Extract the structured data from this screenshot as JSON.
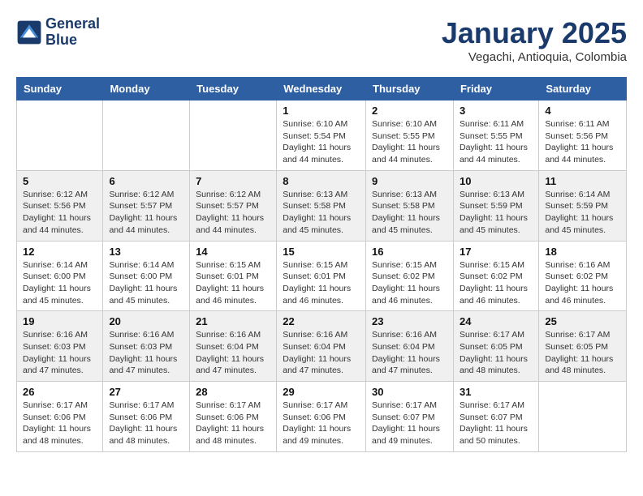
{
  "header": {
    "logo_line1": "General",
    "logo_line2": "Blue",
    "month_title": "January 2025",
    "location": "Vegachi, Antioquia, Colombia"
  },
  "weekdays": [
    "Sunday",
    "Monday",
    "Tuesday",
    "Wednesday",
    "Thursday",
    "Friday",
    "Saturday"
  ],
  "weeks": [
    [
      {
        "day": "",
        "sunrise": "",
        "sunset": "",
        "daylight": ""
      },
      {
        "day": "",
        "sunrise": "",
        "sunset": "",
        "daylight": ""
      },
      {
        "day": "",
        "sunrise": "",
        "sunset": "",
        "daylight": ""
      },
      {
        "day": "1",
        "sunrise": "Sunrise: 6:10 AM",
        "sunset": "Sunset: 5:54 PM",
        "daylight": "Daylight: 11 hours and 44 minutes."
      },
      {
        "day": "2",
        "sunrise": "Sunrise: 6:10 AM",
        "sunset": "Sunset: 5:55 PM",
        "daylight": "Daylight: 11 hours and 44 minutes."
      },
      {
        "day": "3",
        "sunrise": "Sunrise: 6:11 AM",
        "sunset": "Sunset: 5:55 PM",
        "daylight": "Daylight: 11 hours and 44 minutes."
      },
      {
        "day": "4",
        "sunrise": "Sunrise: 6:11 AM",
        "sunset": "Sunset: 5:56 PM",
        "daylight": "Daylight: 11 hours and 44 minutes."
      }
    ],
    [
      {
        "day": "5",
        "sunrise": "Sunrise: 6:12 AM",
        "sunset": "Sunset: 5:56 PM",
        "daylight": "Daylight: 11 hours and 44 minutes."
      },
      {
        "day": "6",
        "sunrise": "Sunrise: 6:12 AM",
        "sunset": "Sunset: 5:57 PM",
        "daylight": "Daylight: 11 hours and 44 minutes."
      },
      {
        "day": "7",
        "sunrise": "Sunrise: 6:12 AM",
        "sunset": "Sunset: 5:57 PM",
        "daylight": "Daylight: 11 hours and 44 minutes."
      },
      {
        "day": "8",
        "sunrise": "Sunrise: 6:13 AM",
        "sunset": "Sunset: 5:58 PM",
        "daylight": "Daylight: 11 hours and 45 minutes."
      },
      {
        "day": "9",
        "sunrise": "Sunrise: 6:13 AM",
        "sunset": "Sunset: 5:58 PM",
        "daylight": "Daylight: 11 hours and 45 minutes."
      },
      {
        "day": "10",
        "sunrise": "Sunrise: 6:13 AM",
        "sunset": "Sunset: 5:59 PM",
        "daylight": "Daylight: 11 hours and 45 minutes."
      },
      {
        "day": "11",
        "sunrise": "Sunrise: 6:14 AM",
        "sunset": "Sunset: 5:59 PM",
        "daylight": "Daylight: 11 hours and 45 minutes."
      }
    ],
    [
      {
        "day": "12",
        "sunrise": "Sunrise: 6:14 AM",
        "sunset": "Sunset: 6:00 PM",
        "daylight": "Daylight: 11 hours and 45 minutes."
      },
      {
        "day": "13",
        "sunrise": "Sunrise: 6:14 AM",
        "sunset": "Sunset: 6:00 PM",
        "daylight": "Daylight: 11 hours and 45 minutes."
      },
      {
        "day": "14",
        "sunrise": "Sunrise: 6:15 AM",
        "sunset": "Sunset: 6:01 PM",
        "daylight": "Daylight: 11 hours and 46 minutes."
      },
      {
        "day": "15",
        "sunrise": "Sunrise: 6:15 AM",
        "sunset": "Sunset: 6:01 PM",
        "daylight": "Daylight: 11 hours and 46 minutes."
      },
      {
        "day": "16",
        "sunrise": "Sunrise: 6:15 AM",
        "sunset": "Sunset: 6:02 PM",
        "daylight": "Daylight: 11 hours and 46 minutes."
      },
      {
        "day": "17",
        "sunrise": "Sunrise: 6:15 AM",
        "sunset": "Sunset: 6:02 PM",
        "daylight": "Daylight: 11 hours and 46 minutes."
      },
      {
        "day": "18",
        "sunrise": "Sunrise: 6:16 AM",
        "sunset": "Sunset: 6:02 PM",
        "daylight": "Daylight: 11 hours and 46 minutes."
      }
    ],
    [
      {
        "day": "19",
        "sunrise": "Sunrise: 6:16 AM",
        "sunset": "Sunset: 6:03 PM",
        "daylight": "Daylight: 11 hours and 47 minutes."
      },
      {
        "day": "20",
        "sunrise": "Sunrise: 6:16 AM",
        "sunset": "Sunset: 6:03 PM",
        "daylight": "Daylight: 11 hours and 47 minutes."
      },
      {
        "day": "21",
        "sunrise": "Sunrise: 6:16 AM",
        "sunset": "Sunset: 6:04 PM",
        "daylight": "Daylight: 11 hours and 47 minutes."
      },
      {
        "day": "22",
        "sunrise": "Sunrise: 6:16 AM",
        "sunset": "Sunset: 6:04 PM",
        "daylight": "Daylight: 11 hours and 47 minutes."
      },
      {
        "day": "23",
        "sunrise": "Sunrise: 6:16 AM",
        "sunset": "Sunset: 6:04 PM",
        "daylight": "Daylight: 11 hours and 47 minutes."
      },
      {
        "day": "24",
        "sunrise": "Sunrise: 6:17 AM",
        "sunset": "Sunset: 6:05 PM",
        "daylight": "Daylight: 11 hours and 48 minutes."
      },
      {
        "day": "25",
        "sunrise": "Sunrise: 6:17 AM",
        "sunset": "Sunset: 6:05 PM",
        "daylight": "Daylight: 11 hours and 48 minutes."
      }
    ],
    [
      {
        "day": "26",
        "sunrise": "Sunrise: 6:17 AM",
        "sunset": "Sunset: 6:06 PM",
        "daylight": "Daylight: 11 hours and 48 minutes."
      },
      {
        "day": "27",
        "sunrise": "Sunrise: 6:17 AM",
        "sunset": "Sunset: 6:06 PM",
        "daylight": "Daylight: 11 hours and 48 minutes."
      },
      {
        "day": "28",
        "sunrise": "Sunrise: 6:17 AM",
        "sunset": "Sunset: 6:06 PM",
        "daylight": "Daylight: 11 hours and 48 minutes."
      },
      {
        "day": "29",
        "sunrise": "Sunrise: 6:17 AM",
        "sunset": "Sunset: 6:06 PM",
        "daylight": "Daylight: 11 hours and 49 minutes."
      },
      {
        "day": "30",
        "sunrise": "Sunrise: 6:17 AM",
        "sunset": "Sunset: 6:07 PM",
        "daylight": "Daylight: 11 hours and 49 minutes."
      },
      {
        "day": "31",
        "sunrise": "Sunrise: 6:17 AM",
        "sunset": "Sunset: 6:07 PM",
        "daylight": "Daylight: 11 hours and 50 minutes."
      },
      {
        "day": "",
        "sunrise": "",
        "sunset": "",
        "daylight": ""
      }
    ]
  ]
}
